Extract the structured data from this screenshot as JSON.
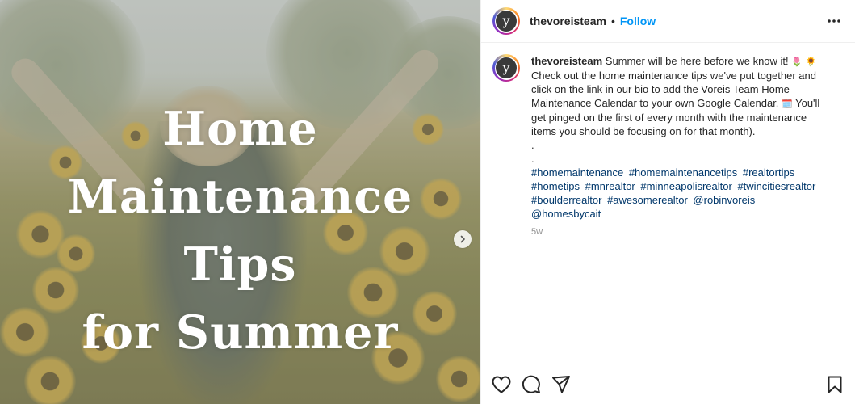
{
  "post": {
    "author": {
      "username": "thevoreisteam",
      "avatar_letter": "y"
    },
    "header": {
      "separator": "•",
      "follow_label": "Follow",
      "more_icon": "more-horizontal-icon"
    },
    "media": {
      "overlay_lines": [
        "Home",
        "Maintenance",
        "Tips",
        "for Summer"
      ],
      "next_icon": "chevron-right-icon"
    },
    "caption": {
      "username": "thevoreisteam",
      "text_line1": " Summer will be here before we know it! ",
      "emoji1": "🌷",
      "emoji2": "🌻",
      "text_line2": "Check out the home maintenance tips we've put together and click on the link in our bio to add the Voreis Team Home Maintenance Calendar to your own Google Calendar. ",
      "emoji3": "🗓️",
      "text_line3": " You'll get pinged on the first of every month with the maintenance items you should be focusing on for that month).",
      "spacer1": ".",
      "spacer2": ".",
      "hashtags": [
        "#homemaintenance",
        "#homemaintenancetips",
        "#realtortips",
        "#hometips",
        "#mnrealtor",
        "#minneapolisrealtor",
        "#twincitiesrealtor",
        "#boulderrealtor",
        "#awesomerealtor",
        "@robinvoreis",
        "@homesbycait"
      ],
      "timestamp": "5w"
    },
    "actions": {
      "like_icon": "heart-icon",
      "comment_icon": "comment-icon",
      "share_icon": "send-icon",
      "save_icon": "bookmark-icon"
    },
    "colors": {
      "link": "#0095f6",
      "hashtag": "#00376b",
      "text": "#262626",
      "muted": "#8e8e8e"
    }
  }
}
